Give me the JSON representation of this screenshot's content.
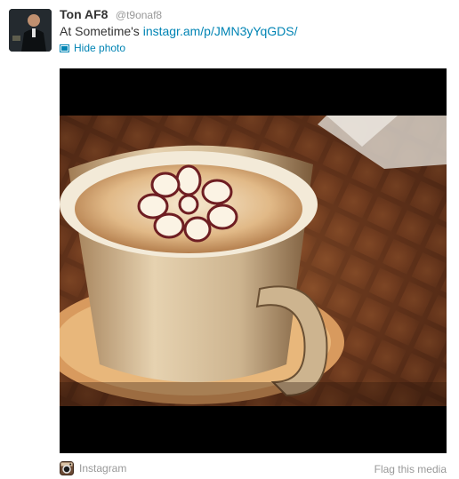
{
  "tweet": {
    "author_name": "Ton AF8",
    "author_handle": "@t9onaf8",
    "text_prefix": "At Sometime's ",
    "link_text": "instagr.am/p/JMN3yYqGDS/",
    "hide_photo_label": "Hide photo"
  },
  "media": {
    "source_label": "Instagram",
    "flag_label": "Flag this media"
  },
  "icons": {
    "photo": "photo-icon",
    "instagram": "instagram-icon"
  },
  "colors": {
    "link": "#0084b4",
    "muted": "#999999",
    "text": "#333333"
  }
}
